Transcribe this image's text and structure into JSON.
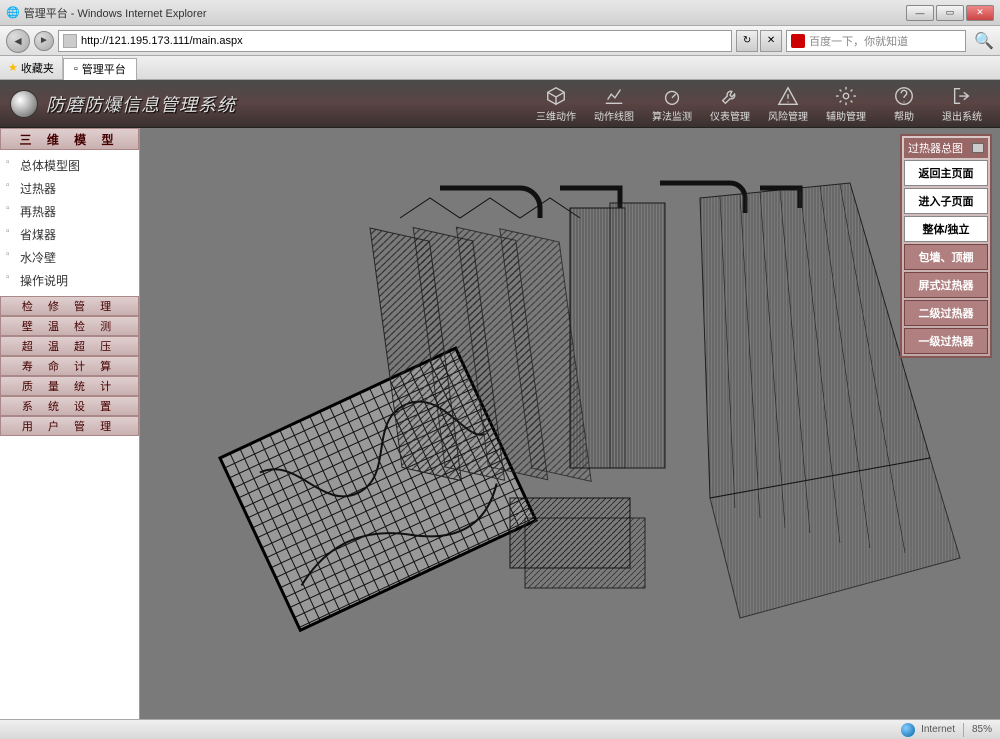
{
  "window": {
    "title": "管理平台 - Windows Internet Explorer"
  },
  "browser": {
    "url": "http://121.195.173.111/main.aspx",
    "search_placeholder": "百度一下，你就知道",
    "favorites_label": "收藏夹",
    "tab_label": "管理平台"
  },
  "app": {
    "title": "防磨防爆信息管理系统",
    "top_menu": [
      "三维动作",
      "动作线图",
      "算法监测",
      "仪表管理",
      "风险管理",
      "辅助管理",
      "帮助",
      "退出系统"
    ]
  },
  "sidebar": {
    "active_section": "三 维 模 型",
    "tree": [
      "总体模型图",
      "过热器",
      "再热器",
      "省煤器",
      "水冷壁",
      "操作说明"
    ],
    "collapsed": [
      "检 修 管 理",
      "壁 温 检 测",
      "超 温 超 压",
      "寿 命 计 算",
      "质 量 统 计",
      "系 统 设 置",
      "用 户 管 理"
    ]
  },
  "right_panel": {
    "title": "过热器总图",
    "buttons_light": [
      "返回主页面",
      "进入子页面",
      "整体/独立"
    ],
    "buttons_dark": [
      "包墙、顶棚",
      "屏式过热器",
      "二级过热器",
      "一级过热器"
    ]
  },
  "status": {
    "zoom": "85%",
    "zone": "Internet"
  }
}
